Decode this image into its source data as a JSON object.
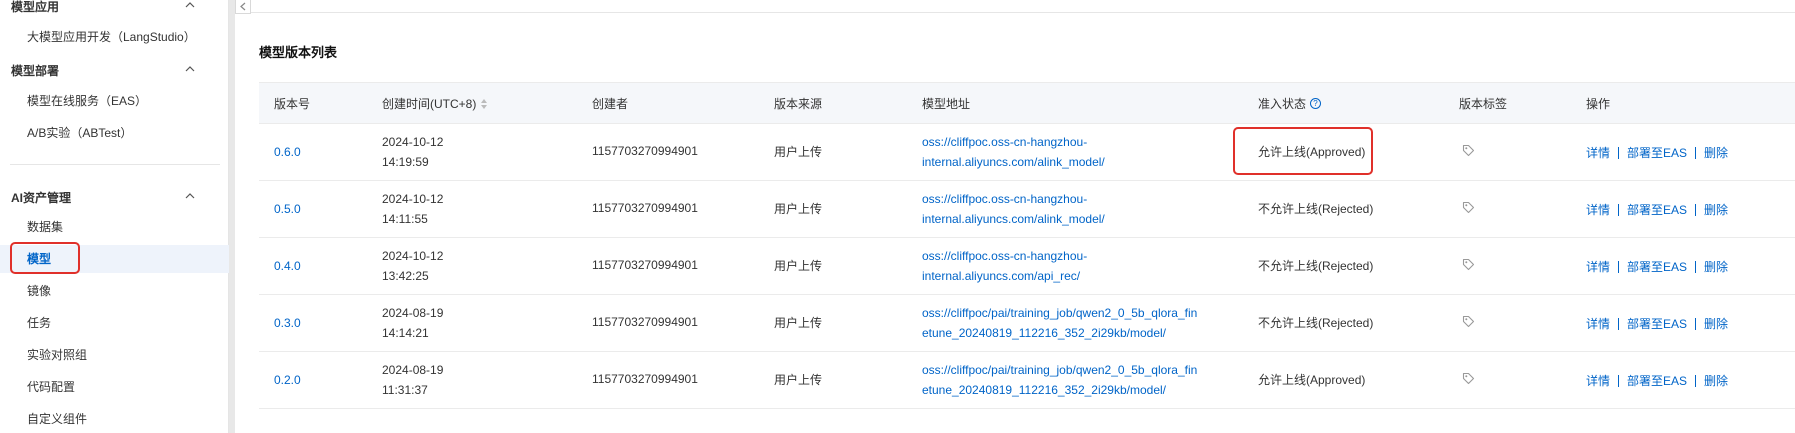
{
  "sidebar": {
    "groups": [
      {
        "title": "模型应用",
        "items": [
          {
            "label": "大模型应用开发（LangStudio）"
          }
        ]
      },
      {
        "title": "模型部署",
        "items": [
          {
            "label": "模型在线服务（EAS）"
          },
          {
            "label": "A/B实验（ABTest）"
          }
        ]
      },
      {
        "title": "AI资产管理",
        "items": [
          {
            "label": "数据集"
          },
          {
            "label": "模型"
          },
          {
            "label": "镜像"
          },
          {
            "label": "任务"
          },
          {
            "label": "实验对照组"
          },
          {
            "label": "代码配置"
          },
          {
            "label": "自定义组件"
          }
        ]
      }
    ],
    "active_item": "模型"
  },
  "main": {
    "section_title": "模型版本列表",
    "columns": [
      "版本号",
      "创建时间(UTC+8)",
      "创建者",
      "版本来源",
      "模型地址",
      "准入状态",
      "版本标签",
      "操作"
    ],
    "status_help_icon": "question-circle-icon",
    "sort_icon": "sort-icon",
    "rows": [
      {
        "version": "0.6.0",
        "date": "2024-10-12",
        "time": "14:19:59",
        "creator": "1157703270994901",
        "source": "用户上传",
        "address_l1": "oss://cliffpoc.oss-cn-hangzhou-",
        "address_l2": "internal.aliyuncs.com/alink_model/",
        "status": "允许上线(Approved)",
        "tag_icon": "tag-icon",
        "actions": [
          "详情",
          "部署至EAS",
          "删除"
        ]
      },
      {
        "version": "0.5.0",
        "date": "2024-10-12",
        "time": "14:11:55",
        "creator": "1157703270994901",
        "source": "用户上传",
        "address_l1": "oss://cliffpoc.oss-cn-hangzhou-",
        "address_l2": "internal.aliyuncs.com/alink_model/",
        "status": "不允许上线(Rejected)",
        "tag_icon": "tag-icon",
        "actions": [
          "详情",
          "部署至EAS",
          "删除"
        ]
      },
      {
        "version": "0.4.0",
        "date": "2024-10-12",
        "time": "13:42:25",
        "creator": "1157703270994901",
        "source": "用户上传",
        "address_l1": "oss://cliffpoc.oss-cn-hangzhou-",
        "address_l2": "internal.aliyuncs.com/api_rec/",
        "status": "不允许上线(Rejected)",
        "tag_icon": "tag-icon",
        "actions": [
          "详情",
          "部署至EAS",
          "删除"
        ]
      },
      {
        "version": "0.3.0",
        "date": "2024-08-19",
        "time": "14:14:21",
        "creator": "1157703270994901",
        "source": "用户上传",
        "address_l1": "oss://cliffpoc/pai/training_job/qwen2_0_5b_qlora_fin",
        "address_l2": "etune_20240819_112216_352_2i29kb/model/",
        "status": "不允许上线(Rejected)",
        "tag_icon": "tag-icon",
        "actions": [
          "详情",
          "部署至EAS",
          "删除"
        ]
      },
      {
        "version": "0.2.0",
        "date": "2024-08-19",
        "time": "11:31:37",
        "creator": "1157703270994901",
        "source": "用户上传",
        "address_l1": "oss://cliffpoc/pai/training_job/qwen2_0_5b_qlora_fin",
        "address_l2": "etune_20240819_112216_352_2i29kb/model/",
        "status": "允许上线(Approved)",
        "tag_icon": "tag-icon",
        "actions": [
          "详情",
          "部署至EAS",
          "删除"
        ]
      }
    ]
  },
  "colors": {
    "link": "#0064c8",
    "highlight": "#e0302a",
    "active_bg": "#eef3fb"
  }
}
